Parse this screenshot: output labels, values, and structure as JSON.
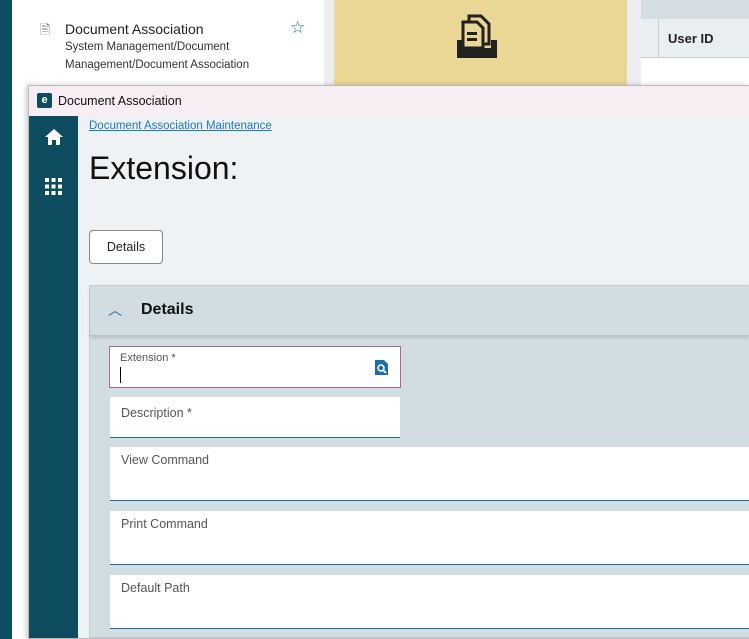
{
  "bg_card": {
    "title": "Document Association",
    "path": "System Management/Document Management/Document Association",
    "icon": "document-icon",
    "favorite_icon": "star-outline-icon"
  },
  "bg_table": {
    "header": "User ID"
  },
  "window": {
    "title": "Document Association",
    "app_icon": "e"
  },
  "nav": {
    "items": [
      {
        "icon": "home-icon",
        "glyph": "⌂"
      },
      {
        "icon": "apps-grid-icon",
        "glyph": "⋮⋮⋮"
      }
    ]
  },
  "breadcrumb": "Document Association Maintenance",
  "heading": "Extension:",
  "details_button": "Details",
  "section": {
    "title": "Details",
    "fields": [
      {
        "label": "Extension *",
        "value": ""
      },
      {
        "label": "Description *",
        "value": ""
      },
      {
        "label": "View Command",
        "value": ""
      },
      {
        "label": "Print Command",
        "value": ""
      },
      {
        "label": "Default Path",
        "value": ""
      }
    ]
  },
  "colors": {
    "nav": "#0e4d5f",
    "accent": "#1a6fa8",
    "tile": "#ead796",
    "focus_border": "#b0668f"
  }
}
